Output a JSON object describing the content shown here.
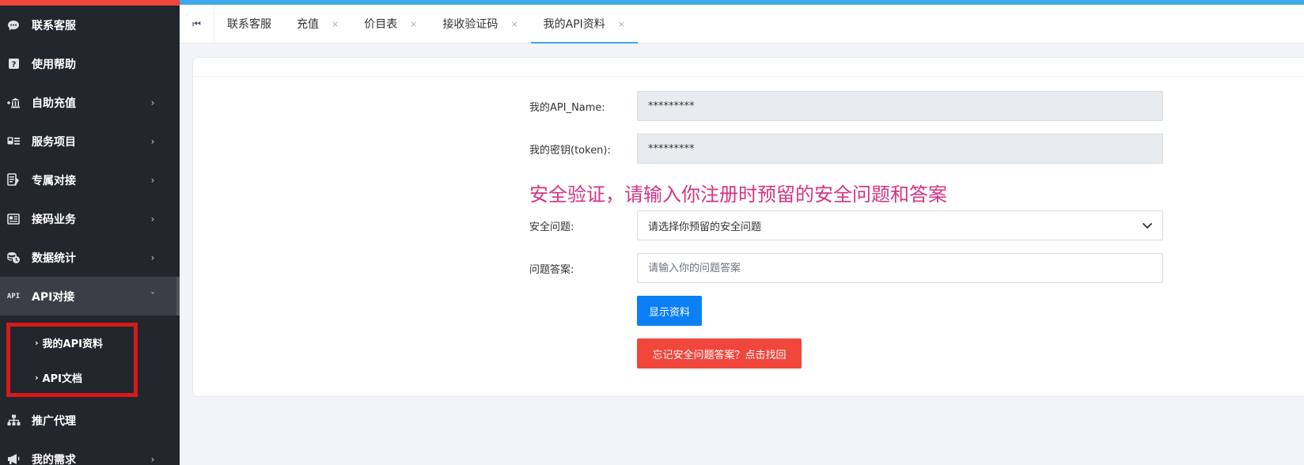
{
  "sidebar": {
    "items": [
      {
        "label": "联系客服",
        "icon": "chat-bubble-icon",
        "has_arrow": false
      },
      {
        "label": "使用帮助",
        "icon": "question-icon",
        "has_arrow": false
      },
      {
        "label": "自助充值",
        "icon": "bank-icon",
        "has_arrow": true
      },
      {
        "label": "服务项目",
        "icon": "card-list-icon",
        "has_arrow": true
      },
      {
        "label": "专属对接",
        "icon": "document-icon",
        "has_arrow": true
      },
      {
        "label": "接码业务",
        "icon": "newspaper-icon",
        "has_arrow": true
      },
      {
        "label": "数据统计",
        "icon": "coins-icon",
        "has_arrow": true
      },
      {
        "label": "API对接",
        "icon": "api-icon",
        "has_arrow": true,
        "expanded": true,
        "icon_text": "API"
      },
      {
        "label": "推广代理",
        "icon": "sitemap-icon",
        "has_arrow": false
      },
      {
        "label": "我的需求",
        "icon": "megaphone-icon",
        "has_arrow": true
      }
    ],
    "submenu": [
      {
        "label": "我的API资料"
      },
      {
        "label": "API文档"
      }
    ],
    "arrow_right": "›",
    "arrow_down": "ˇ"
  },
  "tabs": {
    "first_icon": "⏮",
    "items": [
      {
        "label": "联系客服",
        "closable": false
      },
      {
        "label": "充值",
        "closable": true
      },
      {
        "label": "价目表",
        "closable": true
      },
      {
        "label": "接收验证码",
        "closable": true
      },
      {
        "label": "我的API资料",
        "closable": true,
        "active": true
      }
    ],
    "close_glyph": "×"
  },
  "form": {
    "api_name_label": "我的API_Name:",
    "api_name_value": "*********",
    "token_label": "我的密钥(token):",
    "token_value": "*********",
    "security_title": "安全验证，请输入你注册时预留的安全问题和答案",
    "question_label": "安全问题:",
    "question_selected": "请选择你预留的安全问题",
    "answer_label": "问题答案:",
    "answer_placeholder": "请输入你的问题答案",
    "show_button": "显示资料",
    "forgot_button": "忘记安全问题答案？点击找回"
  },
  "colors": {
    "sidebar_bg": "#22262d",
    "accent_blue": "#3ea8ea",
    "primary_button": "#0d7ff5",
    "danger_button": "#f0463c",
    "title_pink": "#d63384",
    "highlight_red": "#d51a1a"
  }
}
